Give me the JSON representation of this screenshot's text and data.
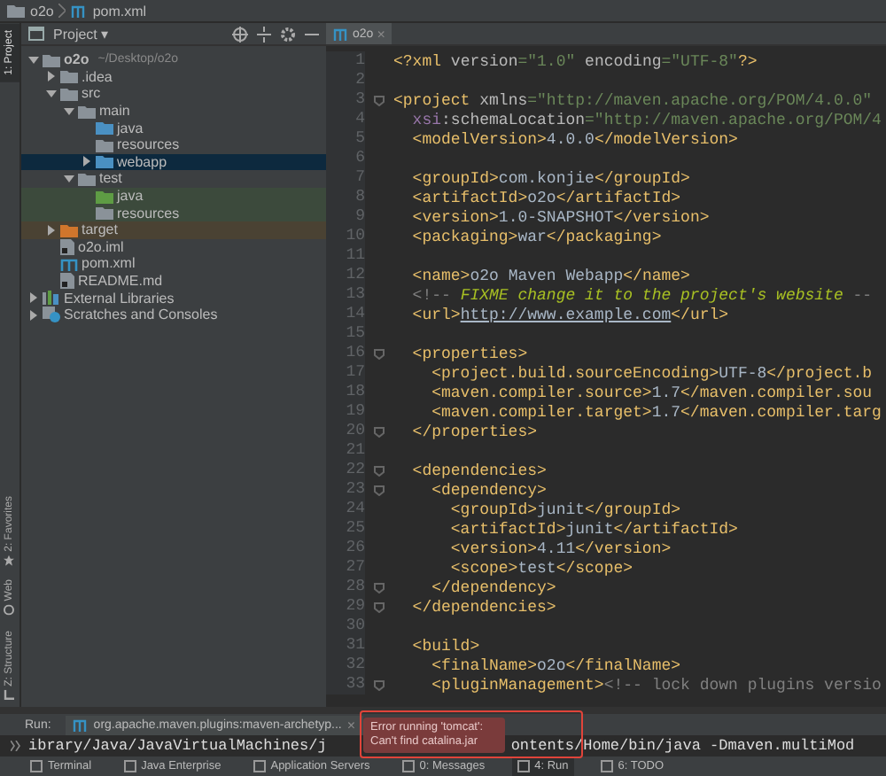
{
  "breadcrumbs": [
    {
      "label": "o2o",
      "kind": "folder"
    },
    {
      "label": "pom.xml",
      "kind": "maven"
    }
  ],
  "left_strip": {
    "top": [
      {
        "label": "1: Project",
        "selected": true
      }
    ],
    "bottom": [
      {
        "label": "2: Favorites",
        "kind": "star"
      },
      {
        "label": "Web",
        "kind": "web"
      },
      {
        "label": "Z: Structure",
        "kind": "structure"
      }
    ]
  },
  "project_panel": {
    "title": "Project ▾",
    "tree": [
      {
        "label": "o2o",
        "hint": "~/Desktop/o2o",
        "kind": "module",
        "expanded": true,
        "selected": false,
        "children": [
          {
            "label": ".idea",
            "kind": "folder",
            "expanded": false,
            "selected": false
          },
          {
            "label": "src",
            "kind": "folder",
            "expanded": true,
            "selected": false,
            "children": [
              {
                "label": "main",
                "kind": "folder",
                "expanded": true,
                "selected": false,
                "children": [
                  {
                    "label": "java",
                    "kind": "source",
                    "selected": false
                  },
                  {
                    "label": "resources",
                    "kind": "resources",
                    "selected": false
                  },
                  {
                    "label": "webapp",
                    "kind": "web",
                    "expanded": false,
                    "selected": true
                  }
                ]
              },
              {
                "label": "test",
                "kind": "folder",
                "expanded": true,
                "selected": false,
                "children": [
                  {
                    "label": "java",
                    "kind": "test-source",
                    "selected": false
                  },
                  {
                    "label": "resources",
                    "kind": "test-resources",
                    "selected": false
                  }
                ]
              }
            ]
          },
          {
            "label": "target",
            "kind": "excluded",
            "expanded": false,
            "selected": false
          },
          {
            "label": "o2o.iml",
            "kind": "module-file",
            "selected": false
          },
          {
            "label": "pom.xml",
            "kind": "maven",
            "selected": false
          },
          {
            "label": "README.md",
            "kind": "markdown",
            "selected": false
          }
        ]
      },
      {
        "label": "External Libraries",
        "kind": "libraries",
        "expanded": false,
        "selected": false
      },
      {
        "label": "Scratches and Consoles",
        "kind": "scratches",
        "expanded": false,
        "selected": false
      }
    ]
  },
  "editor": {
    "tab": {
      "label": "o2o",
      "close": "×"
    },
    "lines": [
      {
        "number": "1",
        "fold": false,
        "segments": [
          {
            "kind": "tag",
            "text": "<?xml"
          },
          {
            "kind": "attr",
            "text": " version"
          },
          {
            "kind": "val",
            "text": "=\"1.0\""
          },
          {
            "kind": "attr",
            "text": " encoding"
          },
          {
            "kind": "val",
            "text": "=\"UTF-8\""
          },
          {
            "kind": "tag",
            "text": "?>"
          }
        ]
      },
      {
        "number": "2",
        "fold": false
      },
      {
        "number": "3",
        "fold": true,
        "segments": [
          {
            "kind": "tag",
            "text": "<project"
          },
          {
            "kind": "attr",
            "text": " xmlns"
          },
          {
            "kind": "val",
            "text": "=\"http://maven.apache.org/POM/4.0.0\""
          }
        ]
      },
      {
        "number": "4",
        "fold": false,
        "segments": [
          {
            "kind": "ns",
            "text": "  xsi"
          },
          {
            "kind": "attr",
            "text": ":schemaLocation"
          },
          {
            "kind": "val",
            "text": "=\"http://maven.apache.org/POM/4"
          }
        ]
      },
      {
        "number": "5",
        "fold": false,
        "segments": [
          {
            "kind": "tag",
            "text": "  <modelVersion>"
          },
          {
            "kind": "text",
            "text": "4.0.0"
          },
          {
            "kind": "tag",
            "text": "</modelVersion>"
          }
        ]
      },
      {
        "number": "6",
        "fold": false
      },
      {
        "number": "7",
        "fold": false,
        "segments": [
          {
            "kind": "tag",
            "text": "  <groupId>"
          },
          {
            "kind": "text",
            "text": "com.konjie"
          },
          {
            "kind": "tag",
            "text": "</groupId>"
          }
        ]
      },
      {
        "number": "8",
        "fold": false,
        "segments": [
          {
            "kind": "tag",
            "text": "  <artifactId>"
          },
          {
            "kind": "text",
            "text": "o2o"
          },
          {
            "kind": "tag",
            "text": "</artifactId>"
          }
        ]
      },
      {
        "number": "9",
        "fold": false,
        "segments": [
          {
            "kind": "tag",
            "text": "  <version>"
          },
          {
            "kind": "text",
            "text": "1.0-SNAPSHOT"
          },
          {
            "kind": "tag",
            "text": "</version>"
          }
        ]
      },
      {
        "number": "10",
        "fold": false,
        "segments": [
          {
            "kind": "tag",
            "text": "  <packaging>"
          },
          {
            "kind": "text",
            "text": "war"
          },
          {
            "kind": "tag",
            "text": "</packaging>"
          }
        ]
      },
      {
        "number": "11",
        "fold": false
      },
      {
        "number": "12",
        "fold": false,
        "segments": [
          {
            "kind": "tag",
            "text": "  <name>"
          },
          {
            "kind": "text",
            "text": "o2o Maven Webapp"
          },
          {
            "kind": "tag",
            "text": "</name>"
          }
        ]
      },
      {
        "number": "13",
        "fold": false,
        "segments": [
          {
            "kind": "comment",
            "text": "  <!-- "
          },
          {
            "kind": "todo",
            "text": "FIXME change it to the project's website"
          },
          {
            "kind": "comment",
            "text": " --"
          }
        ]
      },
      {
        "number": "14",
        "fold": false,
        "segments": [
          {
            "kind": "tag",
            "text": "  <url>"
          },
          {
            "kind": "link",
            "text": "http://www.example.com"
          },
          {
            "kind": "tag",
            "text": "</url>"
          }
        ]
      },
      {
        "number": "15",
        "fold": false
      },
      {
        "number": "16",
        "fold": true,
        "segments": [
          {
            "kind": "tag",
            "text": "  <properties>"
          }
        ]
      },
      {
        "number": "17",
        "fold": false,
        "segments": [
          {
            "kind": "tag",
            "text": "    <project.build.sourceEncoding>"
          },
          {
            "kind": "text",
            "text": "UTF-8"
          },
          {
            "kind": "tag",
            "text": "</project.b"
          }
        ]
      },
      {
        "number": "18",
        "fold": false,
        "segments": [
          {
            "kind": "tag",
            "text": "    <maven.compiler.source>"
          },
          {
            "kind": "text",
            "text": "1.7"
          },
          {
            "kind": "tag",
            "text": "</maven.compiler.sou"
          }
        ]
      },
      {
        "number": "19",
        "fold": false,
        "segments": [
          {
            "kind": "tag",
            "text": "    <maven.compiler.target>"
          },
          {
            "kind": "text",
            "text": "1.7"
          },
          {
            "kind": "tag",
            "text": "</maven.compiler.targ"
          }
        ]
      },
      {
        "number": "20",
        "fold": true,
        "segments": [
          {
            "kind": "tag",
            "text": "  </properties>"
          }
        ]
      },
      {
        "number": "21",
        "fold": false
      },
      {
        "number": "22",
        "fold": true,
        "segments": [
          {
            "kind": "tag",
            "text": "  <dependencies>"
          }
        ]
      },
      {
        "number": "23",
        "fold": true,
        "segments": [
          {
            "kind": "tag",
            "text": "    <dependency>"
          }
        ]
      },
      {
        "number": "24",
        "fold": false,
        "segments": [
          {
            "kind": "tag",
            "text": "      <groupId>"
          },
          {
            "kind": "text",
            "text": "junit"
          },
          {
            "kind": "tag",
            "text": "</groupId>"
          }
        ]
      },
      {
        "number": "25",
        "fold": false,
        "segments": [
          {
            "kind": "tag",
            "text": "      <artifactId>"
          },
          {
            "kind": "text",
            "text": "junit"
          },
          {
            "kind": "tag",
            "text": "</artifactId>"
          }
        ]
      },
      {
        "number": "26",
        "fold": false,
        "segments": [
          {
            "kind": "tag",
            "text": "      <version>"
          },
          {
            "kind": "text",
            "text": "4.11"
          },
          {
            "kind": "tag",
            "text": "</version>"
          }
        ]
      },
      {
        "number": "27",
        "fold": false,
        "segments": [
          {
            "kind": "tag",
            "text": "      <scope>"
          },
          {
            "kind": "text",
            "text": "test"
          },
          {
            "kind": "tag",
            "text": "</scope>"
          }
        ]
      },
      {
        "number": "28",
        "fold": true,
        "segments": [
          {
            "kind": "tag",
            "text": "    </dependency>"
          }
        ]
      },
      {
        "number": "29",
        "fold": true,
        "segments": [
          {
            "kind": "tag",
            "text": "  </dependencies>"
          }
        ]
      },
      {
        "number": "30",
        "fold": false
      },
      {
        "number": "31",
        "fold": false,
        "segments": [
          {
            "kind": "tag",
            "text": "  <build>"
          }
        ]
      },
      {
        "number": "32",
        "fold": false,
        "segments": [
          {
            "kind": "tag",
            "text": "    <finalName>"
          },
          {
            "kind": "text",
            "text": "o2o"
          },
          {
            "kind": "tag",
            "text": "</finalName>"
          }
        ]
      },
      {
        "number": "33",
        "fold": true,
        "segments": [
          {
            "kind": "tag",
            "text": "    <pluginManagement>"
          },
          {
            "kind": "comment",
            "text": "<!-- lock down plugins versio"
          }
        ]
      }
    ]
  },
  "run_panel": {
    "label": "Run:",
    "tab": "org.apache.maven.plugins:maven-archetyp...",
    "close": "×",
    "console_before": "ibrary/Java/JavaVirtualMachines/j",
    "console_after": "ontents/Home/bin/java -Dmaven.multiMod"
  },
  "error_popup": {
    "lines": [
      "Error running 'tomcat':",
      "Can't find catalina.jar"
    ]
  },
  "bottom_toolbar": [
    {
      "label": "Terminal",
      "selected": false
    },
    {
      "label": "Java Enterprise",
      "selected": false
    },
    {
      "label": "Application Servers",
      "selected": false
    },
    {
      "label": "0: Messages",
      "selected": false
    },
    {
      "label": "4: Run",
      "selected": true
    },
    {
      "label": "6: TODO",
      "selected": false
    }
  ]
}
